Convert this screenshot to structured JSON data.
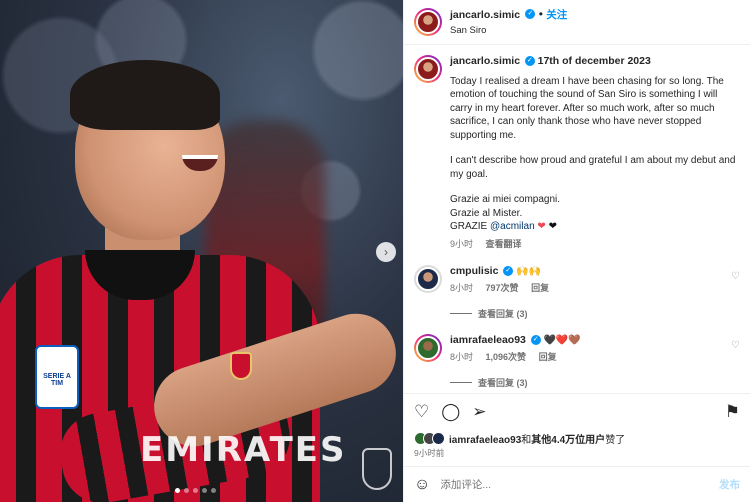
{
  "post": {
    "username": "jancarlo.simic",
    "follow_label": "关注",
    "location": "San Siro",
    "caption": {
      "date": "17th of december 2023",
      "para1": "Today I realised a dream I have been chasing for so long. The emotion of touching the sound of San Siro is something I will carry in my heart forever. After so much work, after so much sacrifice, I can only thank those who have never stopped supporting me.",
      "para2": "I can't describe how proud and grateful I am about my debut and my goal.",
      "line1": "Grazie ai miei compagni.",
      "line2": "Grazie al Mister.",
      "line3_prefix": "GRAZIE",
      "mention": "@acmilan",
      "time": "9小时",
      "translate": "查看翻译"
    },
    "comments": [
      {
        "username": "cmpulisic",
        "text": "🙌🙌",
        "time": "8小时",
        "likes": "797次赞",
        "reply": "回复",
        "view_replies": "查看回复 (3)"
      },
      {
        "username": "iamrafaeleao93",
        "text": "🖤❤️🤎",
        "time": "8小时",
        "likes": "1,096次赞",
        "reply": "回复",
        "view_replies": "查看回复 (3)"
      }
    ],
    "liked_by": "iamrafaeleao93",
    "liked_by_join": "和",
    "liked_others": "其他4.4万位用户",
    "liked_suffix": "赞了",
    "post_time": "9小时前",
    "comment_placeholder": "添加评论...",
    "post_button": "发布"
  },
  "photo": {
    "badge_text": "SERIE A TIM",
    "sponsor_text": "EMIRATES",
    "total_slides": 5,
    "active_slide": 1
  },
  "colors": {
    "accent": "#0095f6",
    "heart": "#ed4956",
    "milan_red": "#c8102e"
  }
}
